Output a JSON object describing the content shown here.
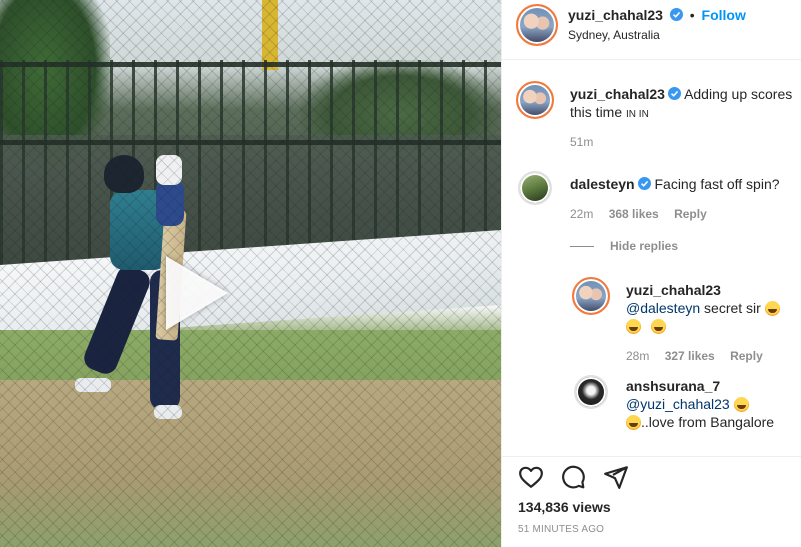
{
  "post": {
    "author": "yuzi_chahal23",
    "follow_label": "Follow",
    "location": "Sydney, Australia",
    "caption_user": "yuzi_chahal23",
    "caption": "Adding up scores this time",
    "caption_flags": "IN IN",
    "caption_time": "51m"
  },
  "comments": [
    {
      "user": "dalesteyn",
      "text": "Facing fast off spin?",
      "time": "22m",
      "likes": "368 likes",
      "reply_label": "Reply"
    },
    {
      "user": "yuzi_chahal23",
      "mention": "@dalesteyn",
      "text": "secret sir",
      "time": "28m",
      "likes": "327 likes",
      "reply_label": "Reply"
    },
    {
      "user": "anshsurana_7",
      "mention": "@yuzi_chahal23",
      "text": "..love from Bangalore"
    }
  ],
  "hide_replies_label": "Hide replies",
  "stats": {
    "views": "134,836 views",
    "posted": "51 MINUTES AGO"
  },
  "colors": {
    "accent": "#0095f6",
    "verified": "#3897f0",
    "muted": "#8e8e8e"
  },
  "icons": [
    "heart-icon",
    "comment-icon",
    "share-icon",
    "play-icon",
    "verified-icon"
  ]
}
